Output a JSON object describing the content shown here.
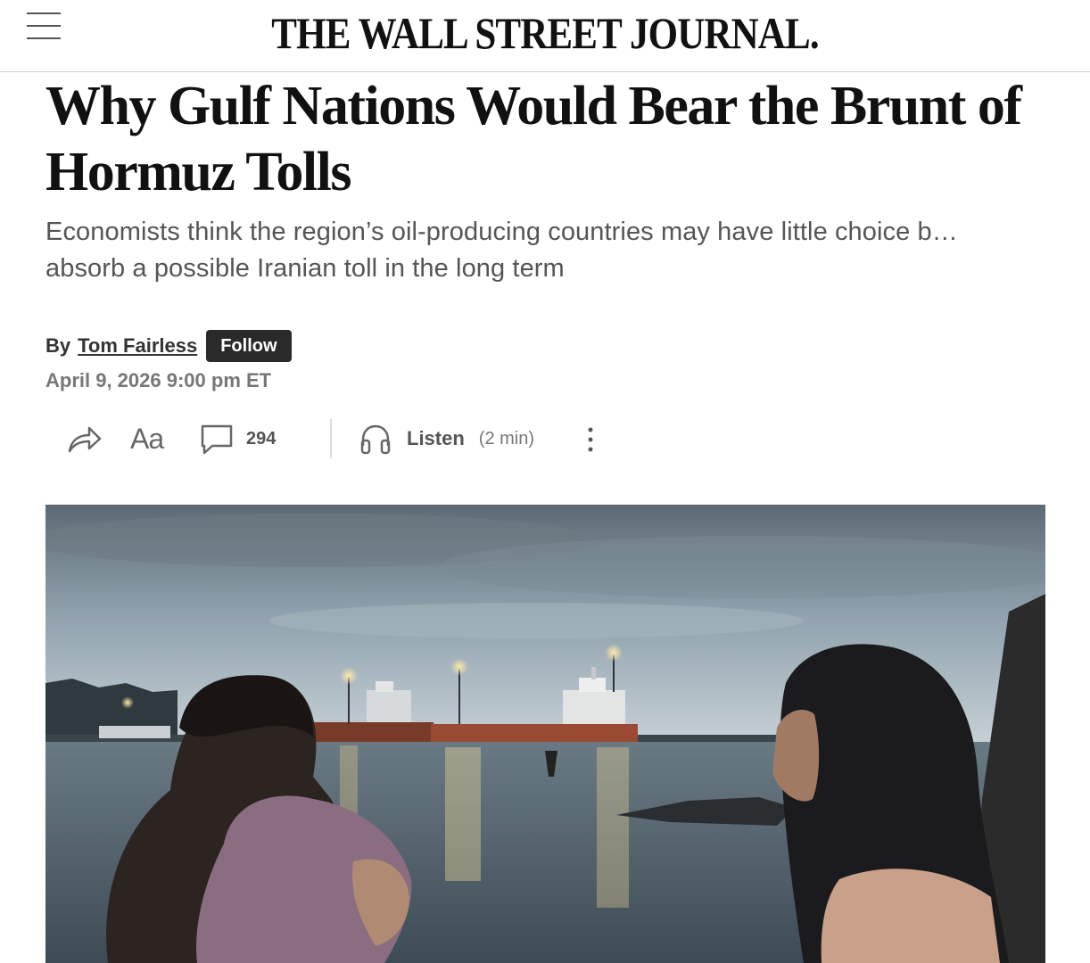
{
  "masthead": {
    "title": "THE WALL STREET JOURNAL."
  },
  "article": {
    "headline": "Why Gulf Nations Would Bear the Brunt of Hormuz Tolls",
    "dek": "Economists think the region’s oil-producing countries may have little choice b… absorb a possible Iranian toll in the long term",
    "byline_prefix": "By",
    "author": "Tom Fairless",
    "follow_label": "Follow",
    "date": "April 9, 2026 9:00 pm ET"
  },
  "toolbar": {
    "share_icon": "share-icon",
    "text_size_label": "Aa",
    "comments_icon": "comment-icon",
    "comment_count": "294",
    "listen_icon": "headphones-icon",
    "listen_label": "Listen",
    "listen_duration": "(2 min)",
    "more_icon": "more-vertical-icon"
  },
  "photo": {
    "sky_color": "#8fa1ad",
    "water_color": "#4f5f6b"
  }
}
